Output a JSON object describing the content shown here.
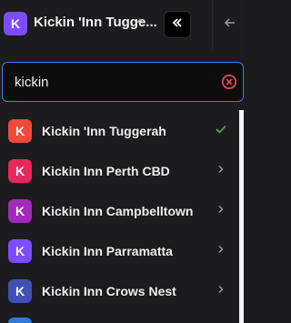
{
  "header": {
    "workspace_initial": "K",
    "workspace_title": "Kickin 'Inn Tugge...",
    "workspace_avatar_color": "#7c4dff"
  },
  "search": {
    "value": "kickin",
    "placeholder": ""
  },
  "list": {
    "items": [
      {
        "initial": "K",
        "label": "Kickin 'Inn Tuggerah",
        "color": "#ef4a3c",
        "trailing": "check-icon",
        "selected": true
      },
      {
        "initial": "K",
        "label": "Kickin Inn Perth CBD",
        "color": "#e8285c",
        "trailing": "chevron-right-icon",
        "selected": false
      },
      {
        "initial": "K",
        "label": "Kickin Inn Campbelltown",
        "color": "#a02bb8",
        "trailing": "chevron-right-icon",
        "selected": false
      },
      {
        "initial": "K",
        "label": "Kickin Inn Parramatta",
        "color": "#7c4dff",
        "trailing": "chevron-right-icon",
        "selected": false
      },
      {
        "initial": "K",
        "label": "Kickin Inn Crows Nest",
        "color": "#3f51b5",
        "trailing": "chevron-right-icon",
        "selected": false
      }
    ]
  },
  "colors": {
    "accent": "#3d7ee8",
    "check": "#4caf50",
    "clear_icon": "#e5484d"
  }
}
